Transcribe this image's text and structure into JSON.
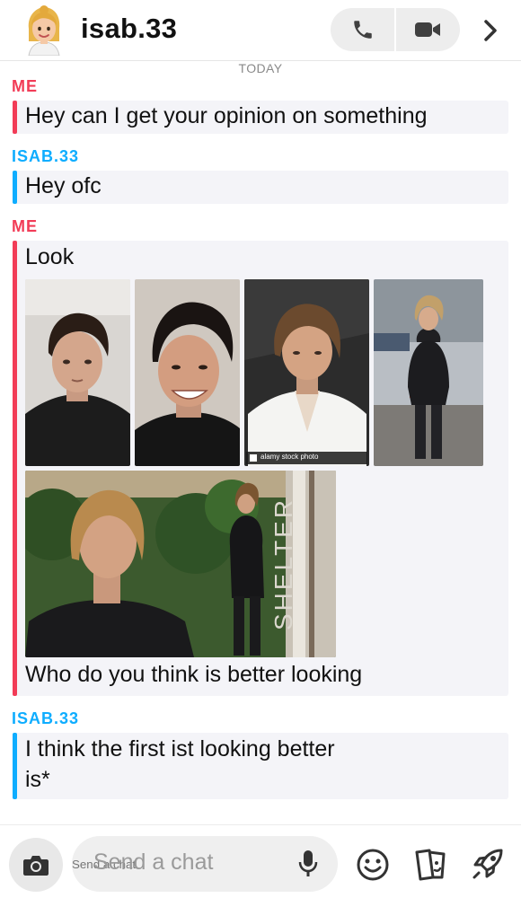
{
  "header": {
    "username": "isab.33",
    "avatar_icon": "bitmoji-avatar-icon",
    "actions": [
      "phone-icon",
      "video-camera-icon",
      "chevron-right-icon"
    ]
  },
  "chat": {
    "date_separator": "TODAY",
    "messages": [
      {
        "sender": "ME",
        "sender_type": "me",
        "text": "Hey can I get your opinion on something"
      },
      {
        "sender": "ISAB.33",
        "sender_type": "friend",
        "text": "Hey ofc"
      },
      {
        "sender": "ME",
        "sender_type": "me",
        "text": "Look",
        "media": [
          {
            "name": "photo-1",
            "watermark": ""
          },
          {
            "name": "photo-2",
            "watermark": ""
          },
          {
            "name": "photo-3",
            "watermark": "alamy stock photo"
          },
          {
            "name": "photo-4",
            "watermark": ""
          },
          {
            "name": "photo-5",
            "sign_text": "SHELTER"
          }
        ],
        "caption": "Who do you think is better looking"
      },
      {
        "sender": "ISAB.33",
        "sender_type": "friend",
        "lines": [
          "I think the first ist looking better",
          "is*"
        ]
      }
    ]
  },
  "input_bar": {
    "placeholder": "Send a chat",
    "icons": [
      "camera-icon",
      "microphone-icon",
      "emoji-icon",
      "sticker-icon",
      "rocket-icon"
    ]
  },
  "colors": {
    "me": "#f23c57",
    "friend": "#0eadff",
    "bubble_bg": "#f4f4f8",
    "placeholder": "#9a9a9a"
  }
}
